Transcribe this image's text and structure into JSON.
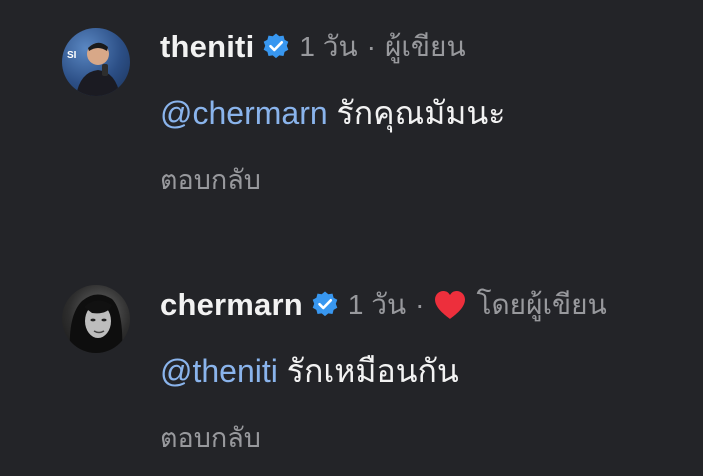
{
  "comments": [
    {
      "username": "theniti",
      "time": "1 วัน",
      "dot": "·",
      "author_label": "ผู้เขียน",
      "mention": "@chermarn",
      "text": "รักคุณมัมนะ",
      "reply_label": "ตอบกลับ",
      "verified": true,
      "liked_by_author": false
    },
    {
      "username": "chermarn",
      "time": "1 วัน",
      "dot": "·",
      "author_label": "โดยผู้เขียน",
      "mention": "@theniti",
      "text": "รักเหมือนกัน",
      "reply_label": "ตอบกลับ",
      "verified": true,
      "liked_by_author": true
    }
  ],
  "icons": {
    "verified": "verified-badge-icon",
    "heart": "heart-icon"
  },
  "colors": {
    "background": "#232428",
    "username": "#f2f2f2",
    "meta": "#98999d",
    "mention": "#8ab4ec",
    "verified": "#3897f0",
    "heart": "#ed2f3c"
  }
}
